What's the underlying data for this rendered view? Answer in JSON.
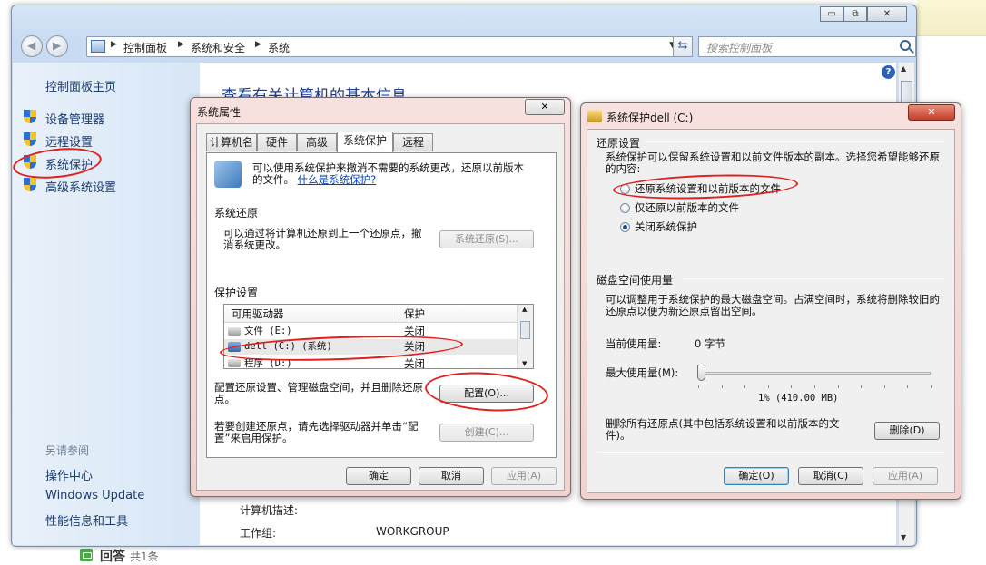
{
  "explorer": {
    "caption_buttons": {
      "minimize": "▭",
      "maximize": "⧉",
      "close": "✕"
    },
    "breadcrumb": [
      "控制面板",
      "系统和安全",
      "系统"
    ],
    "search_placeholder": "搜索控制面板",
    "sidebar": {
      "home": "控制面板主页",
      "items": [
        "设备管理器",
        "远程设置",
        "系统保护",
        "高级系统设置"
      ],
      "see_also_title": "另请参阅",
      "see_also": [
        "操作中心",
        "Windows Update",
        "性能信息和工具"
      ]
    },
    "heading": "查看有关计算机的基本信息",
    "info": {
      "computer_desc_label": "计算机描述:",
      "workgroup_label": "工作组:",
      "workgroup_value": "WORKGROUP"
    }
  },
  "answer": {
    "label": "回答",
    "count": "共1条"
  },
  "sysprops": {
    "title": "系统属性",
    "close": "✕",
    "tabs": [
      "计算机名",
      "硬件",
      "高级",
      "系统保护",
      "远程"
    ],
    "intro_text": "可以使用系统保护来撤消不需要的系统更改，还原以前版本的文件。",
    "intro_link": "什么是系统保护?",
    "restore_group": "系统还原",
    "restore_text": "可以通过将计算机还原到上一个还原点，撤消系统更改。",
    "restore_button": "系统还原(S)...",
    "protect_group": "保护设置",
    "table_headers": [
      "可用驱动器",
      "保护"
    ],
    "drives": [
      {
        "name": "文件 (E:)",
        "protection": "关闭"
      },
      {
        "name": "dell (C:) (系统)",
        "protection": "关闭"
      },
      {
        "name": "程序 (D:)",
        "protection": "关闭"
      }
    ],
    "configure_text": "配置还原设置、管理磁盘空间，并且删除还原点。",
    "configure_button": "配置(O)...",
    "create_text": "若要创建还原点，请先选择驱动器并单击“配置”来启用保护。",
    "create_button": "创建(C)...",
    "ok": "确定",
    "cancel": "取消",
    "apply": "应用(A)"
  },
  "protdlg": {
    "title": "系统保护dell (C:)",
    "close": "✕",
    "restore_group": "还原设置",
    "restore_desc": "系统保护可以保留系统设置和以前文件版本的副本。选择您希望能够还原的内容:",
    "options": [
      "还原系统设置和以前版本的文件",
      "仅还原以前版本的文件",
      "关闭系统保护"
    ],
    "selected_option": 2,
    "disk_group": "磁盘空间使用量",
    "disk_desc": "可以调整用于系统保护的最大磁盘空间。占满空间时，系统将删除较旧的还原点以便为新还原点留出空间。",
    "current_label": "当前使用量:",
    "current_value": "0 字节",
    "max_label": "最大使用量(M):",
    "max_percent": 0.01,
    "max_value": "1% (410.00 MB)",
    "delete_text": "删除所有还原点(其中包括系统设置和以前版本的文件)。",
    "delete_button": "删除(D)",
    "ok": "确定(O)",
    "cancel": "取消(C)",
    "apply": "应用(A)"
  },
  "colors": {
    "annotation_red": "#e01f1f",
    "link_blue": "#0645ad",
    "heading_blue": "#1e3d8a"
  }
}
